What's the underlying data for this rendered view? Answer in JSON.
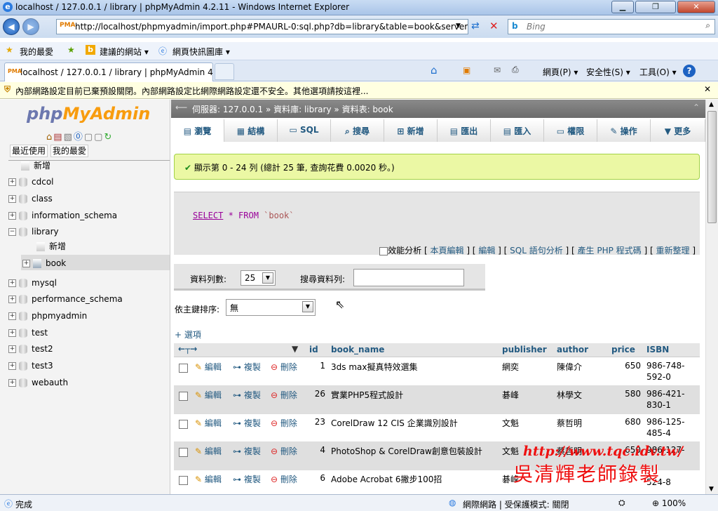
{
  "window": {
    "title": "localhost / 127.0.0.1 / library | phpMyAdmin 4.2.11 - Windows Internet Explorer"
  },
  "browser": {
    "url": "http://localhost/phpmyadmin/import.php#PMAURL-0:sql.php?db=library&table=book&server",
    "search_placeholder": "Bing",
    "favorites": [
      "我的最愛",
      "建議的網站 ▾",
      "網頁快訊圖庫 ▾"
    ],
    "tab_title": "localhost / 127.0.0.1 / library | phpMyAdmin 4....",
    "toolbar": [
      "網頁(P) ▾",
      "安全性(S) ▾",
      "工具(O) ▾"
    ],
    "infobar": "內部網路設定目前已棄預設關閉。內部網路設定比網際網路設定還不安全。其他選項請按這裡..."
  },
  "sidebar": {
    "logo_php": "php",
    "logo_myadmin": "MyAdmin",
    "tabs": [
      "最近使用",
      "我的最愛"
    ],
    "items": [
      {
        "label": "新增"
      },
      {
        "label": "cdcol"
      },
      {
        "label": "class"
      },
      {
        "label": "information_schema"
      },
      {
        "label": "library"
      },
      {
        "label": "新增"
      },
      {
        "label": "book"
      },
      {
        "label": "mysql"
      },
      {
        "label": "performance_schema"
      },
      {
        "label": "phpmyadmin"
      },
      {
        "label": "test"
      },
      {
        "label": "test2"
      },
      {
        "label": "test3"
      },
      {
        "label": "webauth"
      }
    ]
  },
  "breadcrumb": {
    "server": "伺服器: 127.0.0.1",
    "db": "資料庫: library",
    "table": "資料表: book"
  },
  "tabs": [
    "瀏覽",
    "結構",
    "SQL",
    "搜尋",
    "新增",
    "匯出",
    "匯入",
    "權限",
    "操作",
    "更多"
  ],
  "notice": "顯示第 0 - 24 列 (總計 25 筆, 查詢花費 0.0020 秒。)",
  "query": {
    "select": "SELECT",
    "rest": " * FROM ",
    "table": "`book`",
    "profiling": "效能分析",
    "links": [
      "本頁編輯",
      "編輯",
      "SQL 語句分析",
      "產生 PHP 程式碼",
      "重新整理"
    ]
  },
  "controls": {
    "rows_label": "資料列數:",
    "rows_value": "25",
    "search_label": "搜尋資料列:",
    "sort_label": "依主鍵排序:",
    "sort_value": "無",
    "options": "+ 選項"
  },
  "table": {
    "columns": [
      "id",
      "book_name",
      "publisher",
      "author",
      "price",
      "ISBN"
    ],
    "actions": {
      "edit": "編輯",
      "copy": "複製",
      "delete": "刪除"
    },
    "rows": [
      {
        "id": "1",
        "book_name": "3ds max擬真特效選集",
        "publisher": "網奕",
        "author": "陳偉介",
        "price": "650",
        "isbn1": "986-748-",
        "isbn2": "592-0"
      },
      {
        "id": "26",
        "book_name": "實業PHP5程式設計",
        "publisher": "碁峰",
        "author": "林學文",
        "price": "580",
        "isbn1": "986-421-",
        "isbn2": "830-1"
      },
      {
        "id": "23",
        "book_name": "CorelDraw 12 CIS 企業識別設計",
        "publisher": "文魁",
        "author": "蔡哲明",
        "price": "680",
        "isbn1": "986-125-",
        "isbn2": "485-4"
      },
      {
        "id": "4",
        "book_name": "PhotoShop & CorelDraw創意包裝設計",
        "publisher": "文魁",
        "author": "蔡哲明",
        "price": "650",
        "isbn1": "986-127-",
        "isbn2": ""
      },
      {
        "id": "6",
        "book_name": "Adobe Acrobat 6撇步100招",
        "publisher": "碁峰",
        "author": "",
        "price": "",
        "isbn1": "",
        "isbn2": "524-8"
      }
    ]
  },
  "status": {
    "left": "完成",
    "zone": "網際網路 | 受保護模式: 關閉",
    "zoom": "100%"
  },
  "watermark": {
    "url": "http://www.tqc.idv.tw/",
    "name": "吳清輝老師錄製"
  }
}
